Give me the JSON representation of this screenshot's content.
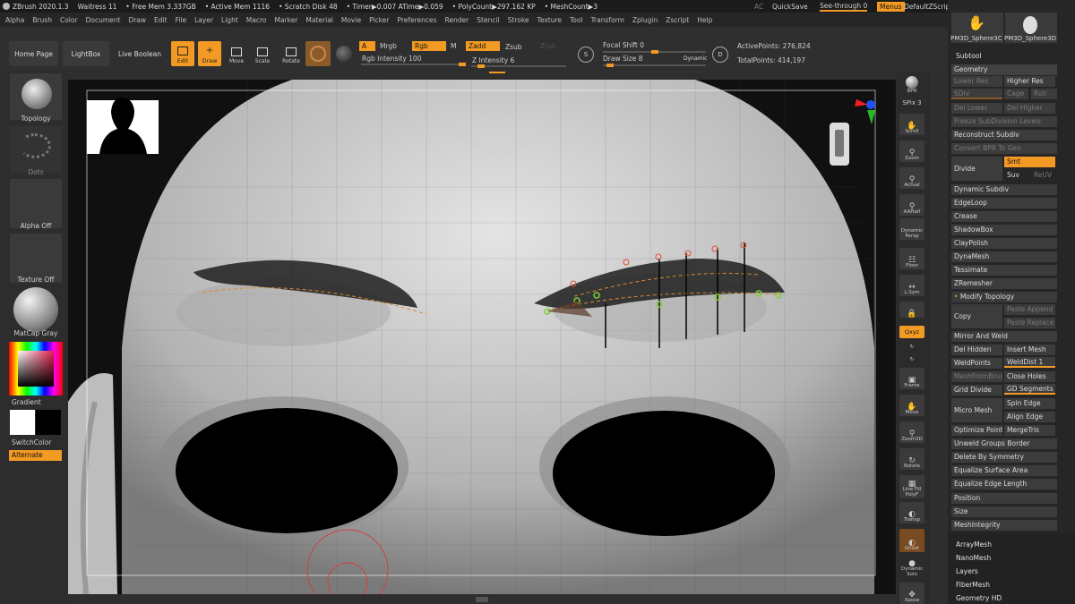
{
  "app": {
    "title": "ZBrush 2020.1.3",
    "document": "Waitress 11"
  },
  "status": {
    "free_mem": "• Free Mem 3.337GB",
    "active_mem": "• Active Mem 1116",
    "scratch_disk": "• Scratch Disk 48",
    "timer": "• Timer▶0.007 ATime▶0.059",
    "polycount": "• PolyCount▶297.162 KP",
    "meshcount": "• MeshCount▶3"
  },
  "titlebar_right": {
    "ac": "AC",
    "quicksave": "QuickSave",
    "see_through": "See-through  0",
    "menus": "Menus",
    "script": "DefaultZScript"
  },
  "menu": [
    "Alpha",
    "Brush",
    "Color",
    "Document",
    "Draw",
    "Edit",
    "File",
    "Layer",
    "Light",
    "Macro",
    "Marker",
    "Material",
    "Movie",
    "Picker",
    "Preferences",
    "Render",
    "Stencil",
    "Stroke",
    "Texture",
    "Tool",
    "Transform",
    "Zplugin",
    "Zscript",
    "Help"
  ],
  "toolbar": {
    "home": "Home Page",
    "lightbox": "LightBox",
    "live_boolean": "Live Boolean",
    "edit": "Edit",
    "draw": "Draw",
    "move": "Move",
    "scale": "Scale",
    "rotate": "Rotate",
    "a": "A",
    "mrgb": "Mrgb",
    "rgb": "Rgb",
    "m": "M",
    "zadd": "Zadd",
    "zsub": "Zsub",
    "zcut": "Zcut",
    "rgb_intensity": "Rgb Intensity 100",
    "z_intensity": "Z Intensity 6",
    "focal_shift": "Focal Shift 0",
    "draw_size": "Draw Size 8",
    "dynamic": "Dynamic",
    "s": "S",
    "d": "D",
    "active_points": "ActivePoints: 276,824",
    "total_points": "TotalPoints: 414,197"
  },
  "left": {
    "topology": "Topology",
    "dots": "Dots",
    "alpha": "Alpha Off",
    "texture": "Texture Off",
    "matcap": "MatCap Gray",
    "gradient": "Gradient",
    "switch_color": "SwitchColor",
    "alternate": "Alternate"
  },
  "shelf": [
    "BPR",
    "SPix 3",
    "Scroll",
    "Zoom",
    "Actual",
    "AAHalf",
    "Dynamic Persp",
    "Floor",
    "L.Sym",
    "",
    "Qxyz",
    "",
    "",
    "Frame",
    "Move",
    "Zoom3D",
    "Rotate",
    "Line Fill PolyF",
    "Transp",
    "Ghost",
    "Dynamic Solo",
    "Xpose"
  ],
  "panel": {
    "thumb1": "PM3D_Sphere3C",
    "thumb2": "PM3D_Sphere3D",
    "subtool": "Subtool",
    "geometry": "Geometry",
    "lower_res": "Lower Res",
    "higher_res": "Higher Res",
    "sdiv": "SDiv",
    "cage": "Cage",
    "rstr": "Rstr",
    "del_lower": "Del Lower",
    "del_higher": "Del Higher",
    "freeze": "Freeze SubDivision Levels",
    "reconstruct": "Reconstruct Subdiv",
    "convert_bpr": "Convert BPR To Geo",
    "divide": "Divide",
    "smt": "Smt",
    "suv": "Suv",
    "reuv": "ReUV",
    "dynamic_subdiv": "Dynamic Subdiv",
    "edgeloop": "EdgeLoop",
    "crease": "Crease",
    "shadowbox": "ShadowBox",
    "claypolish": "ClayPolish",
    "dynamesh": "DynaMesh",
    "tessimate": "Tessimate",
    "zremesher": "ZRemesher",
    "modify_topology": "Modify Topology",
    "copy": "Copy",
    "paste_append": "Paste Append",
    "paste_replace": "Paste Replace",
    "mirror_weld": "Mirror And Weld",
    "del_hidden": "Del Hidden",
    "insert_mesh": "Insert Mesh",
    "weldpoints": "WeldPoints",
    "welddist": "WeldDist 1",
    "meshfrombrush": "MeshFromBrush",
    "close_holes": "Close Holes",
    "grid_divide": "Grid Divide",
    "gd_segments": "GD Segments 3",
    "micro_mesh": "Micro Mesh",
    "spin_edge": "Spin Edge",
    "align_edge": "Align Edge",
    "optimize_points": "Optimize Points",
    "mergetris": "MergeTris",
    "unweld": "Unweld Groups Border",
    "delete_symmetry": "Delete By Symmetry",
    "equalize_area": "Equalize Surface Area",
    "equalize_edge": "Equalize Edge Length",
    "position": "Position",
    "size": "Size",
    "meshintegrity": "MeshIntegrity",
    "arraymesh": "ArrayMesh",
    "nanomesh": "NanoMesh",
    "layers": "Layers",
    "fibermesh": "FiberMesh",
    "geometry_hd": "Geometry HD"
  },
  "colors": {
    "accent": "#f39a24",
    "panel": "#262626",
    "button": "#3c3c3c"
  }
}
